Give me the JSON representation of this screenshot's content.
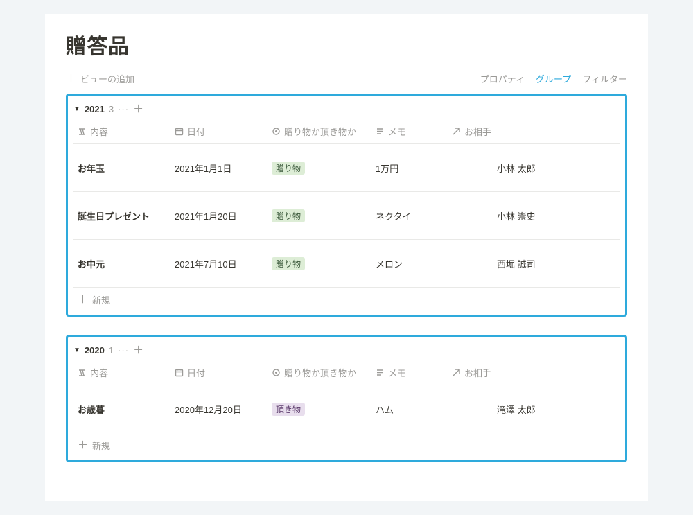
{
  "page_title": "贈答品",
  "toolbar": {
    "add_view": "ビューの追加",
    "property": "プロパティ",
    "group": "グループ",
    "filter": "フィルター"
  },
  "columns": {
    "content": "内容",
    "date": "日付",
    "type": "贈り物か頂き物か",
    "memo": "メモ",
    "person": "お相手"
  },
  "new_label": "新規",
  "groups": [
    {
      "name": "2021",
      "count": "3",
      "rows": [
        {
          "content": "お年玉",
          "date": "2021年1月1日",
          "type": "贈り物",
          "type_color": "green",
          "memo": "1万円",
          "person": "小林 太郎"
        },
        {
          "content": "誕生日プレゼント",
          "date": "2021年1月20日",
          "type": "贈り物",
          "type_color": "green",
          "memo": "ネクタイ",
          "person": "小林 崇史"
        },
        {
          "content": "お中元",
          "date": "2021年7月10日",
          "type": "贈り物",
          "type_color": "green",
          "memo": "メロン",
          "person": "西堀 誠司"
        }
      ]
    },
    {
      "name": "2020",
      "count": "1",
      "rows": [
        {
          "content": "お歳暮",
          "date": "2020年12月20日",
          "type": "頂き物",
          "type_color": "purple",
          "memo": "ハム",
          "person": "滝澤 太郎"
        }
      ]
    }
  ]
}
